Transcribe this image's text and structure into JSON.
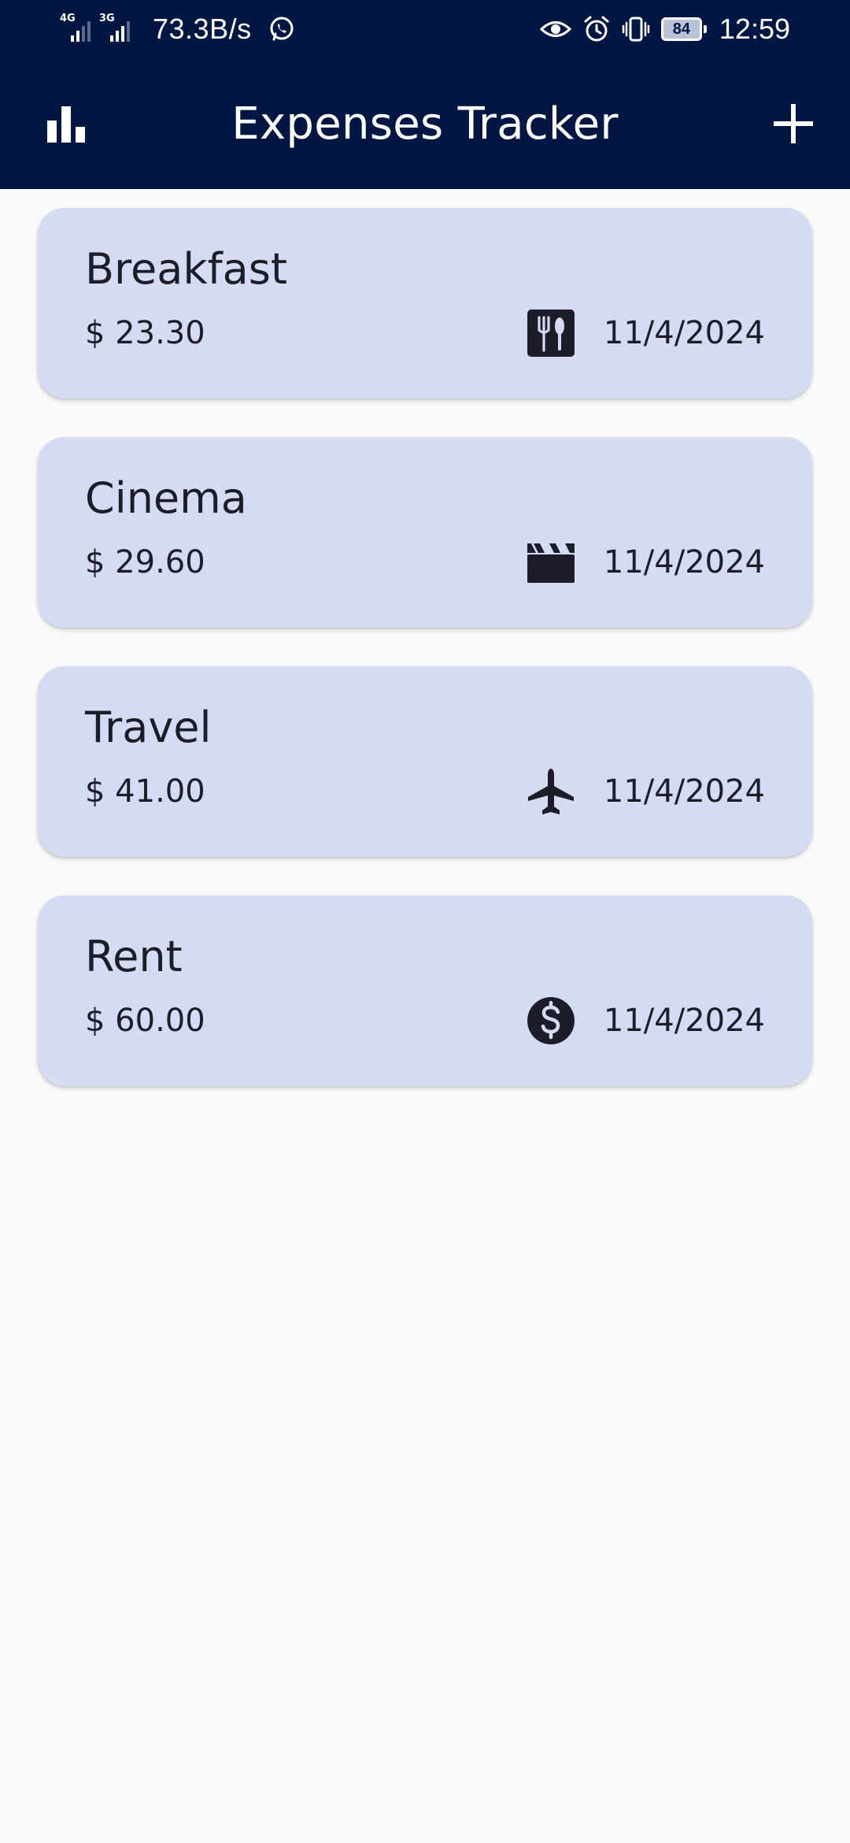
{
  "status_bar": {
    "network_1": "4G",
    "network_2": "3G",
    "speed": "73.3B/s",
    "battery": "84",
    "time": "12:59"
  },
  "app_bar": {
    "title": "Expenses Tracker",
    "left_icon": "bar-chart-icon",
    "right_icon": "add-icon"
  },
  "colors": {
    "app_bar": "#001643",
    "card_background": "#d4dbf3",
    "page_background": "#fafafa",
    "text": "#1c1d29"
  },
  "expenses": [
    {
      "title": "Breakfast",
      "amount": "$ 23.30",
      "category_icon": "food-icon",
      "date": "11/4/2024"
    },
    {
      "title": "Cinema",
      "amount": "$ 29.60",
      "category_icon": "movie-icon",
      "date": "11/4/2024"
    },
    {
      "title": "Travel",
      "amount": "$ 41.00",
      "category_icon": "flight-icon",
      "date": "11/4/2024"
    },
    {
      "title": "Rent",
      "amount": "$ 60.00",
      "category_icon": "money-icon",
      "date": "11/4/2024"
    }
  ]
}
